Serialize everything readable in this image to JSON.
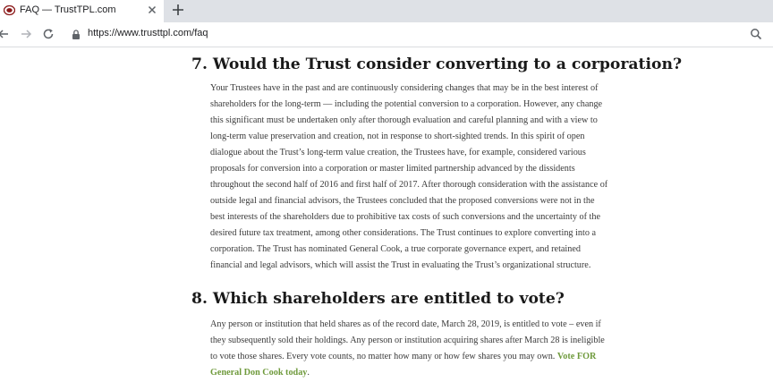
{
  "browser": {
    "tab_title": "FAQ — TrustTPL.com",
    "url": "https://www.trusttpl.com/faq"
  },
  "faq": [
    {
      "heading": "7. Would the Trust consider converting to a corporation?",
      "lines": [
        "Your Trustees have in the past and are continuously considering changes that may be in the best interest of",
        "shareholders for the long-term — including the potential conversion to a corporation.  However, any change",
        "this significant must be undertaken only after thorough evaluation and careful planning and with a view to",
        "long-term value preservation and creation, not in response to short-sighted trends.  In this spirit of open",
        "dialogue about the Trust’s long-term value creation, the Trustees have, for example, considered various",
        "proposals for conversion into a corporation or master limited partnership advanced by the dissidents",
        "throughout the second half of 2016 and first half of 2017. After thorough consideration with the assistance of",
        "outside legal and financial advisors, the Trustees concluded that the proposed conversions were not in the",
        "best interests of the shareholders due to prohibitive tax costs of such conversions and the uncertainty of the",
        "desired future tax treatment, among other considerations.  The Trust continues to explore converting into a",
        "corporation. The Trust has nominated General Cook, a true corporate governance expert, and retained",
        "financial and legal advisors, which will assist the Trust in evaluating the Trust’s organizational structure."
      ]
    },
    {
      "heading": "8. Which shareholders are entitled to vote?",
      "lines": [
        "Any person or institution that held shares as of the record date, March 28, 2019, is entitled to vote – even if",
        "they subsequently sold their holdings. Any person or institution acquiring shares after March 28 is ineligible",
        "to vote those shares. Every vote counts, no matter how many or how few shares you may own. "
      ],
      "link_part1": "Vote FOR",
      "link_part2": "General Don Cook today",
      "trailing": "."
    }
  ]
}
